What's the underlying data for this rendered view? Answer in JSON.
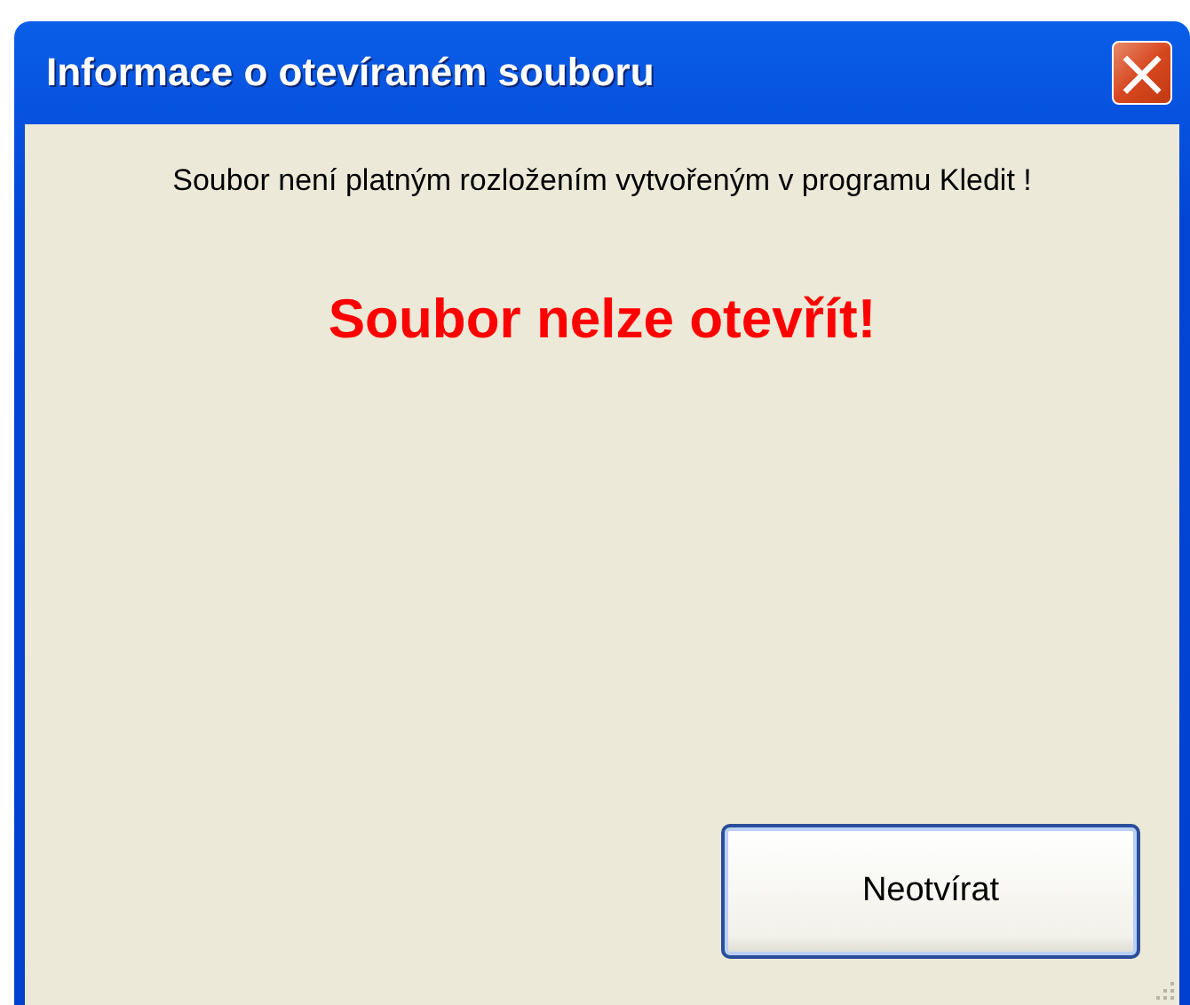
{
  "window": {
    "title": "Informace o otevíraném souboru",
    "close_button": "×"
  },
  "message": "Soubor není platným rozložením vytvořeným v programu Kledit !",
  "error": "Soubor nelze otevřít!",
  "buttons": [
    "Neotvírat"
  ]
}
